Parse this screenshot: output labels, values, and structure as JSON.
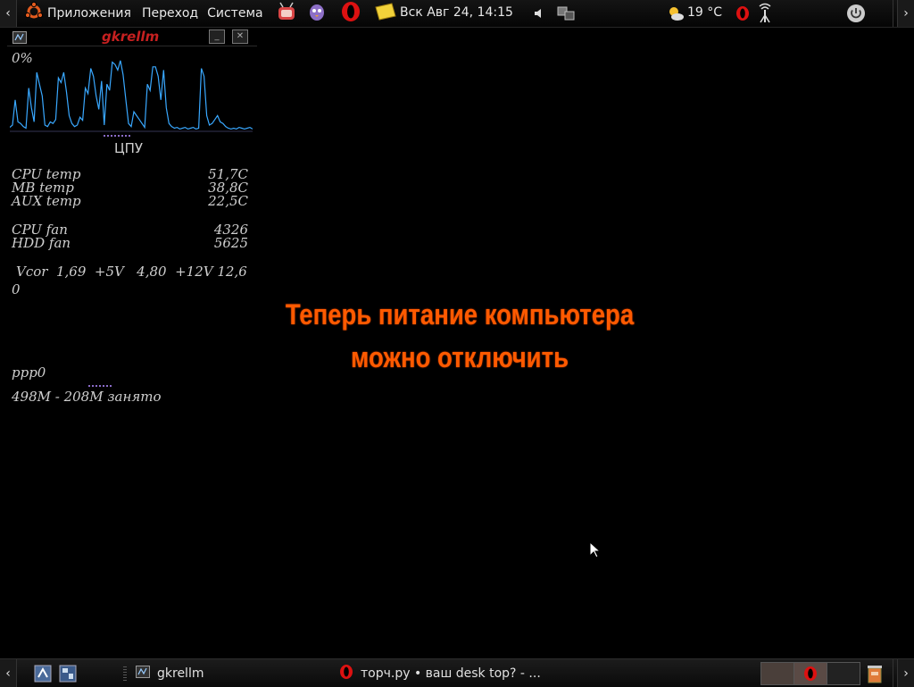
{
  "top_panel": {
    "menu_apps": "Приложения",
    "menu_places": "Переход",
    "menu_system": "Система",
    "clock": "Вск Авг 24, 14:15",
    "weather_temp": "19 °C"
  },
  "gkrellm": {
    "title": "gkrellm",
    "cpu_percent": "0%",
    "cpu_label": "ЦПУ",
    "cpu_chart": {
      "values": [
        5,
        8,
        40,
        12,
        10,
        6,
        4,
        55,
        30,
        12,
        75,
        60,
        45,
        8,
        6,
        12,
        10,
        15,
        68,
        62,
        75,
        50,
        20,
        10,
        6,
        8,
        18,
        14,
        55,
        48,
        80,
        70,
        45,
        28,
        64,
        8,
        60,
        52,
        88,
        85,
        78,
        90,
        72,
        40,
        10,
        6,
        25,
        20,
        15,
        10,
        5,
        60,
        52,
        82,
        82,
        70,
        40,
        78,
        30,
        10,
        6,
        4,
        5,
        3,
        4,
        5,
        3,
        4,
        5,
        3,
        4,
        80,
        70,
        20,
        8,
        10,
        15,
        20,
        12,
        10,
        6,
        4,
        3,
        4,
        3,
        5,
        4,
        3,
        4,
        5,
        3
      ],
      "ylim": [
        0,
        100
      ]
    },
    "sensors": [
      {
        "label": "CPU temp",
        "value": "51,7C"
      },
      {
        "label": "MB temp",
        "value": "38,8C"
      },
      {
        "label": "AUX temp",
        "value": "22,5C"
      }
    ],
    "fans": [
      {
        "label": "CPU fan",
        "value": "4326"
      },
      {
        "label": "HDD fan",
        "value": "5625"
      }
    ],
    "voltage_line1": "Vcor  1,69  +5V   4,80  +12V 12,6",
    "voltage_line2": "0",
    "net_label": "ppp0",
    "mem_label": "498M - 208M занято"
  },
  "message": {
    "line1": "Теперь питание компьютера",
    "line2": "можно отключить"
  },
  "bottom_panel": {
    "task_gkrellm": "gkrellm",
    "task_opera": "торч.ру • ваш desk top? - ..."
  },
  "colors": {
    "message": "#ff5a00",
    "gkrellm_title": "#c62020",
    "cpu_graph": "#39a8ff"
  }
}
